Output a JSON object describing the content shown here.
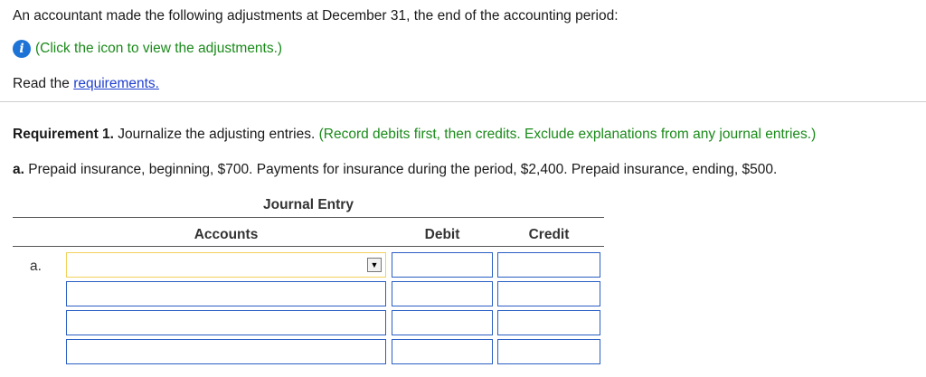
{
  "intro": {
    "text": "An accountant made the following adjustments at December 31, the end of the accounting period:",
    "info_link": "(Click the icon to view the adjustments.)",
    "read_prefix": "Read the ",
    "requirements_link": "requirements."
  },
  "requirement1": {
    "label": "Requirement 1.",
    "text": " Journalize the adjusting entries.",
    "instructions": " (Record debits first, then credits. Exclude explanations from any journal entries.)"
  },
  "part_a": {
    "label": "a.",
    "text": " Prepaid insurance, beginning, $700. Payments for insurance during the period, $2,400. Prepaid insurance, ending, $500."
  },
  "journal": {
    "title": "Journal Entry",
    "headers": {
      "accounts": "Accounts",
      "debit": "Debit",
      "credit": "Credit"
    },
    "row_label": "a.",
    "dropdown_icon": "triangle-down-icon",
    "rows": [
      {
        "account": "",
        "debit": "",
        "credit": ""
      },
      {
        "account": "",
        "debit": "",
        "credit": ""
      },
      {
        "account": "",
        "debit": "",
        "credit": ""
      },
      {
        "account": "",
        "debit": "",
        "credit": ""
      }
    ]
  },
  "colors": {
    "info_icon": "#1d73d6",
    "instruction_text": "#1a8a1a",
    "link": "#1f3fd0",
    "input_border": "#2a5fc4",
    "selected_input_border": "#f2d15a"
  }
}
